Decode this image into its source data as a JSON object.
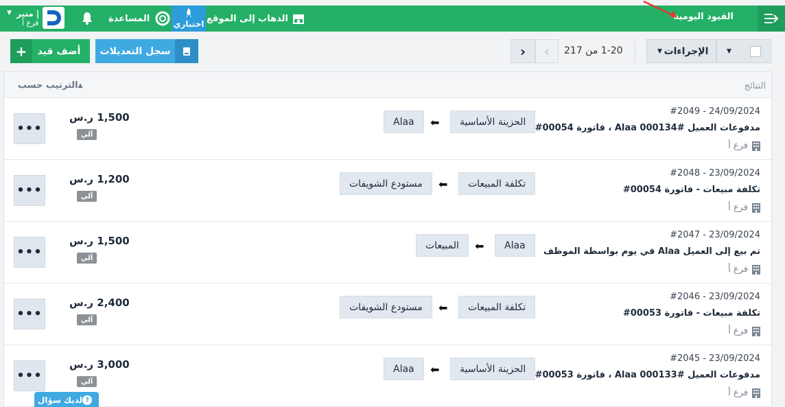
{
  "topbar": {
    "page_title": "القيود اليومية",
    "visit_site": "الذهاب إلى الموقع",
    "trial": "اختباري",
    "help": "المساعدة",
    "user_name": "منير |",
    "user_branch": "فرع أ"
  },
  "toolbar": {
    "add_label": "أضف قيد",
    "add_plus": "+",
    "log_label": "سجل التعديلات",
    "pagination_text": "1-20 من 217",
    "next": "›",
    "prev": "‹",
    "actions_label": "الإجراءات"
  },
  "results": {
    "title": "النتائج",
    "sort_label": "الترتيب حسب"
  },
  "rows": [
    {
      "meta": "24/09/2024 - #2049",
      "desc": "مدفوعات العميل Alaa 000134# ، فاتورة 00054#",
      "branch": "فرع أ",
      "from": "الحزينة الأساسية",
      "to": "Alaa",
      "amount": "1,500 ر.س",
      "badge": "آلي"
    },
    {
      "meta": "23/09/2024 - #2048",
      "desc": "تكلفة مبيعات - فاتورة 00054#",
      "branch": "فرع أ",
      "from": "تكلفة المبيعات",
      "to": "مستودع الشويفات",
      "amount": "1,200 ر.س",
      "badge": "آلي"
    },
    {
      "meta": "23/09/2024 - #2047",
      "desc": "تم بيع إلى العميل Alaa في يوم بواسطة الموظف",
      "branch": "فرع أ",
      "from": "Alaa",
      "to": "المبيعات",
      "amount": "1,500 ر.س",
      "badge": "آلي"
    },
    {
      "meta": "23/09/2024 - #2046",
      "desc": "تكلفة مبيعات - فاتورة 00053#",
      "branch": "فرع أ",
      "from": "تكلفة المبيعات",
      "to": "مستودع الشويفات",
      "amount": "2,400 ر.س",
      "badge": "آلي"
    },
    {
      "meta": "23/09/2024 - #2045",
      "desc": "مدفوعات العميل Alaa 000133# ، فاتورة 00053#",
      "branch": "فرع أ",
      "from": "الحزينة الأساسية",
      "to": "Alaa",
      "amount": "3,000 ر.س",
      "badge": "آلي"
    }
  ],
  "more_label": "•••",
  "help_button": "لديك سؤال",
  "help_q": "?",
  "colors": {
    "brand_green": "#24b066",
    "accent_blue": "#3fa9e2",
    "annotation_red": "#e53935"
  }
}
